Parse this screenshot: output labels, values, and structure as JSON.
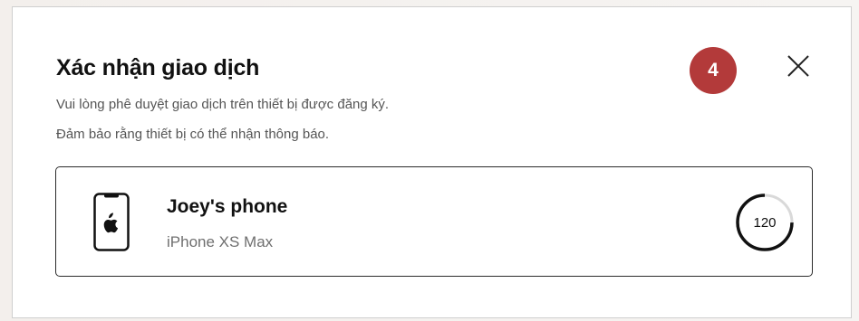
{
  "dialog": {
    "title": "Xác nhận giao dịch",
    "subtitle_line1": "Vui lòng phê duyệt giao dịch trên thiết bị được đăng ký.",
    "subtitle_line2": "Đảm bảo rằng thiết bị có thể nhận thông báo.",
    "step_number": "4",
    "close_icon": "close-icon"
  },
  "device": {
    "icon": "apple-phone-icon",
    "name": "Joey's phone",
    "model": "iPhone XS Max"
  },
  "timer": {
    "remaining": "120",
    "progress_fraction": 0.75
  },
  "colors": {
    "badge": "#b33a3a",
    "text_primary": "#111111",
    "text_secondary": "#555555",
    "border": "#2b2b2b"
  }
}
